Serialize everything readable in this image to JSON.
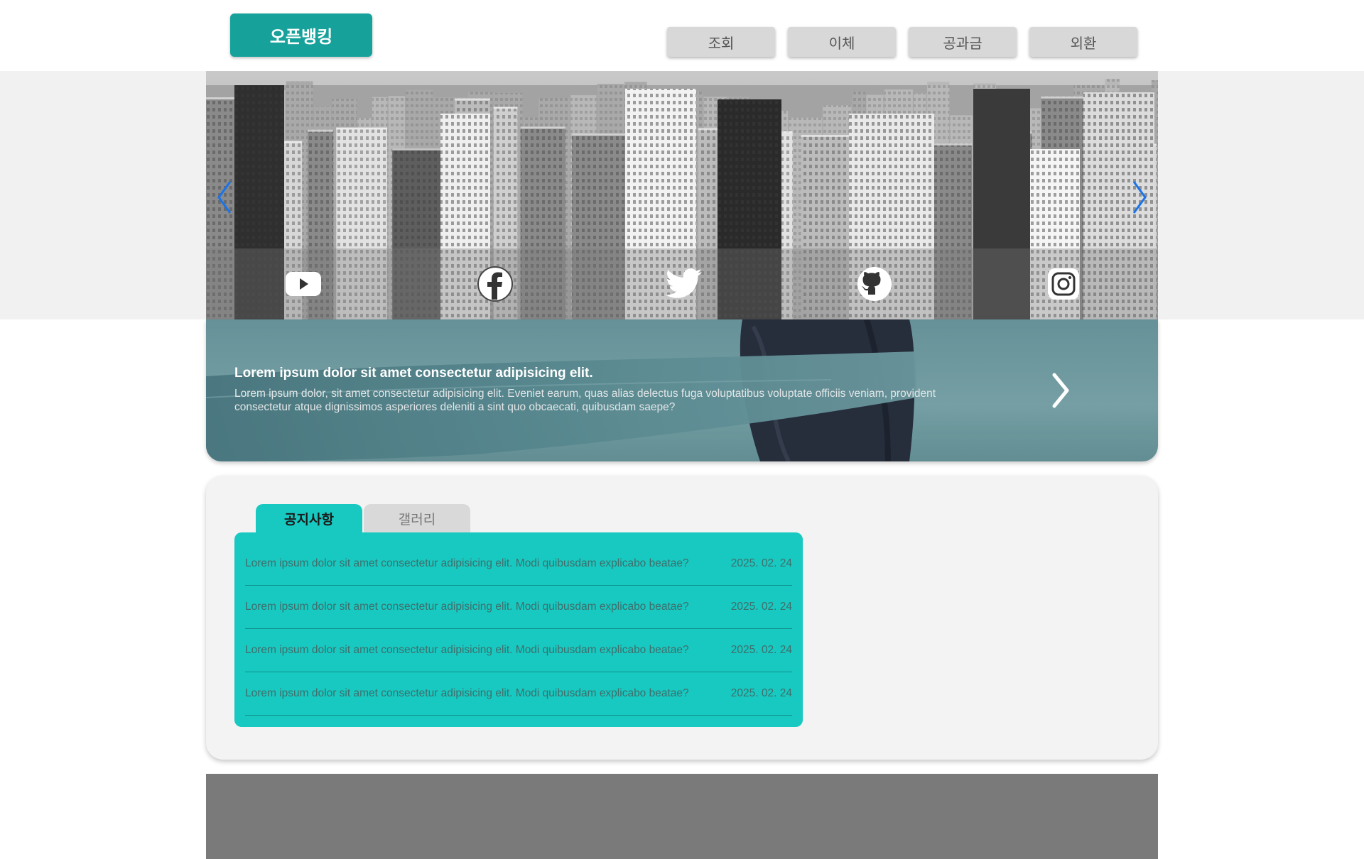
{
  "header": {
    "logo": "오픈뱅킹",
    "nav": [
      {
        "label": "조회"
      },
      {
        "label": "이체"
      },
      {
        "label": "공과금"
      },
      {
        "label": "외환"
      }
    ]
  },
  "hero": {
    "image": "city-skyline-photo",
    "arrows": [
      "chevron-left-icon",
      "chevron-right-icon"
    ],
    "social": [
      "youtube-icon",
      "facebook-icon",
      "twitter-icon",
      "github-icon",
      "instagram-icon"
    ],
    "accent_color": "#1a73e8"
  },
  "banner": {
    "title": "Lorem ipsum dolor sit amet consectetur adipisicing elit.",
    "description": "Lorem ipsum dolor, sit amet consectetur adipisicing elit. Eveniet earum, quas alias delectus fuga voluptatibus voluptate officiis veniam, provident consectetur atque dignissimos asperiores deleniti a sint quo obcaecati, quibusdam saepe?",
    "next_icon": "chevron-right-icon"
  },
  "notice": {
    "tabs": [
      {
        "label": "공지사항",
        "active": true
      },
      {
        "label": "갤러리",
        "active": false
      }
    ],
    "items": [
      {
        "text": "Lorem ipsum dolor sit amet consectetur adipisicing elit. Modi quibusdam explicabo beatae?",
        "date": "2025. 02. 24"
      },
      {
        "text": "Lorem ipsum dolor sit amet consectetur adipisicing elit. Modi quibusdam explicabo beatae?",
        "date": "2025. 02. 24"
      },
      {
        "text": "Lorem ipsum dolor sit amet consectetur adipisicing elit. Modi quibusdam explicabo beatae?",
        "date": "2025. 02. 24"
      },
      {
        "text": "Lorem ipsum dolor sit amet consectetur adipisicing elit. Modi quibusdam explicabo beatae?",
        "date": "2025. 02. 24"
      }
    ]
  },
  "colors": {
    "brand": "#17a19b",
    "panel": "#18c9c1",
    "footer": "#7a7a7a"
  }
}
